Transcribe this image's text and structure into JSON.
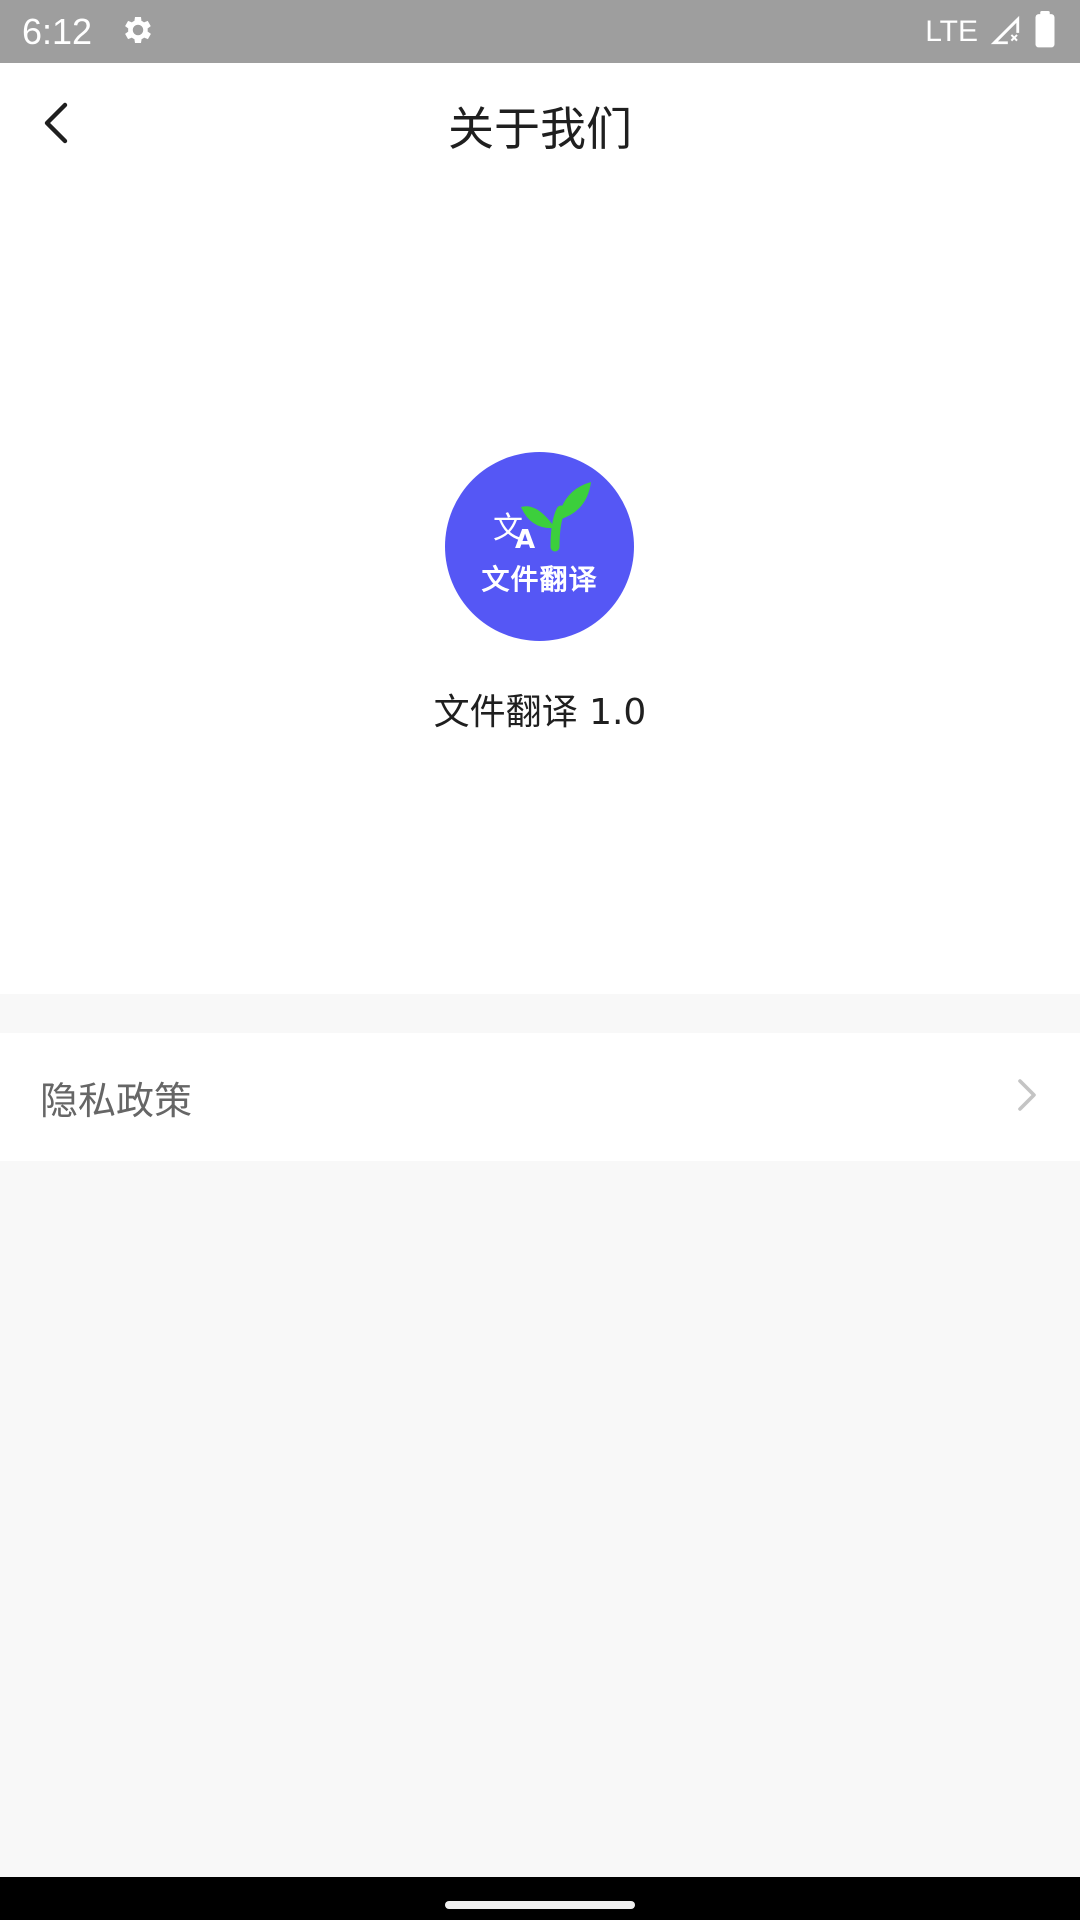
{
  "status_bar": {
    "time": "6:12",
    "network": "LTE",
    "icons": [
      "gear-icon",
      "signal-icon",
      "battery-icon"
    ]
  },
  "header": {
    "title": "关于我们",
    "back_icon": "chevron-left-icon"
  },
  "app_info": {
    "logo_text": "文件翻译",
    "logo_glyph_cn": "文",
    "logo_glyph_en": "A",
    "name_version": "文件翻译 1.0",
    "logo_color": "#5557f5",
    "sprout_color": "#3ccf3c"
  },
  "menu": {
    "items": [
      {
        "label": "隐私政策",
        "icon": "chevron-right-icon"
      }
    ]
  },
  "colors": {
    "status_bar_bg": "#9e9e9e",
    "page_bg": "#f8f8f8",
    "card_bg": "#ffffff"
  }
}
